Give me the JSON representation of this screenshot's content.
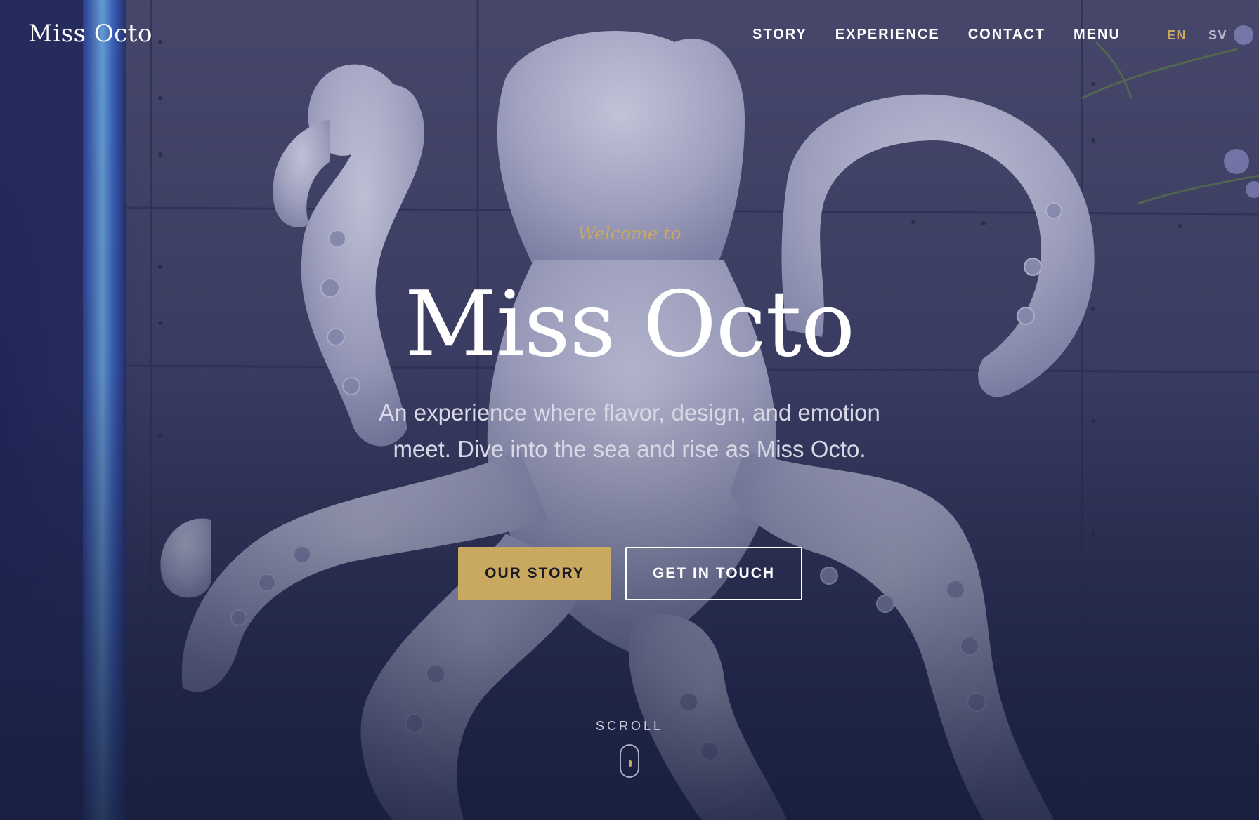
{
  "header": {
    "logo": "Miss Octo",
    "nav": [
      {
        "label": "STORY"
      },
      {
        "label": "EXPERIENCE"
      },
      {
        "label": "CONTACT"
      },
      {
        "label": "MENU"
      }
    ],
    "languages": [
      {
        "label": "EN",
        "active": true
      },
      {
        "label": "SV",
        "active": false
      }
    ]
  },
  "hero": {
    "eyebrow": "Welcome to",
    "title": "Miss Octo",
    "subtitle": "An experience where flavor, design, and emotion meet. Dive into the sea and rise as Miss Octo.",
    "primary_button": "OUR STORY",
    "secondary_button": "GET IN TOUCH",
    "scroll_label": "SCROLL"
  },
  "colors": {
    "accent_gold": "#c9a860",
    "overlay_navy": "#1c2240",
    "text_white": "#ffffff"
  },
  "icons": {
    "scroll_indicator": "mouse-scroll-icon"
  }
}
